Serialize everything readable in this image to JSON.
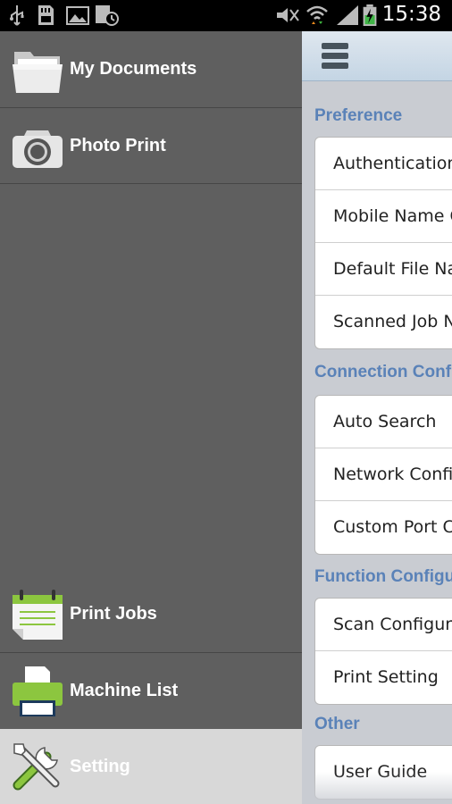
{
  "status_bar": {
    "time": "15:38",
    "left_icons": [
      "usb-icon",
      "sd-card-icon",
      "gallery-icon",
      "alarm-icon"
    ],
    "right_icons": [
      "mute-icon",
      "wifi-icon",
      "signal-icon",
      "battery-charging-icon"
    ]
  },
  "drawer": {
    "items": [
      {
        "label": "My Documents",
        "icon": "folder-icon"
      },
      {
        "label": "Photo Print",
        "icon": "camera-icon"
      },
      {
        "label": "Print Jobs",
        "icon": "notepad-icon"
      },
      {
        "label": "Machine List",
        "icon": "printer-icon"
      },
      {
        "label": "Setting",
        "icon": "tools-icon",
        "active": true
      }
    ]
  },
  "settings": {
    "sections": [
      {
        "title": "Preference",
        "items": [
          "Authentication",
          "Mobile Name C",
          "Default File Na",
          "Scanned Job N"
        ]
      },
      {
        "title": "Connection Conf",
        "items": [
          "Auto Search",
          "Network Confi",
          "Custom Port C"
        ]
      },
      {
        "title": "Function Configu",
        "items": [
          "Scan Configur",
          "Print Setting"
        ]
      },
      {
        "title": "Other",
        "items": [
          "User Guide"
        ]
      }
    ]
  },
  "colors": {
    "drawer_bg": "#5f5f5f",
    "active_bg": "#d8d8d8",
    "section_header": "#5a82b8",
    "pane_bg": "#c9ccd2"
  }
}
